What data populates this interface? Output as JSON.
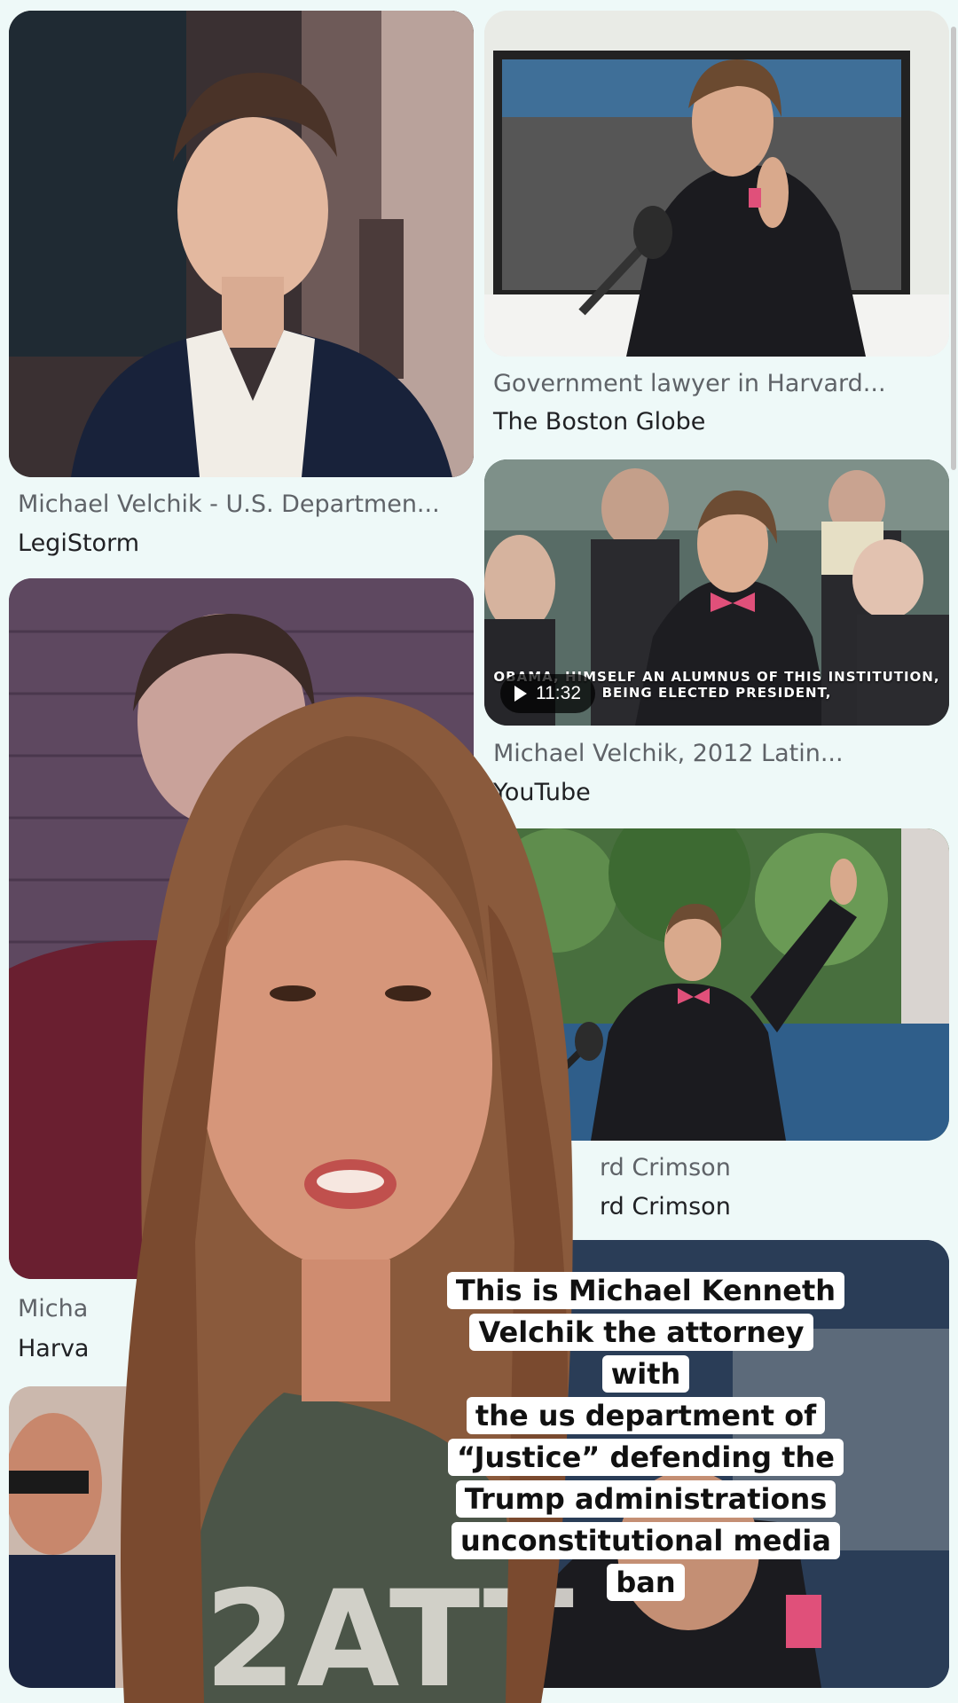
{
  "results": [
    {
      "title": "Michael Velchik - U.S. Departmen...",
      "source": "LegiStorm"
    },
    {
      "title": "Government lawyer in Harvard...",
      "source": "The Boston Globe"
    },
    {
      "title": "Michael Velchik, 2012 Latin...",
      "source": "YouTube",
      "duration": "11:32",
      "banner": "OBAMA, HIMSELF AN ALUMNUS OF THIS INSTITUTION, BEING ELECTED PRESIDENT,"
    },
    {
      "title": "rd Crimson",
      "source": "rd Crimson"
    },
    {
      "title": "Micha",
      "source": "Harva"
    }
  ],
  "overlay": {
    "subtitle_lines": [
      "This is Michael Kenneth",
      "Velchik the attorney with",
      "the us department of",
      "“Justice” defending the",
      "Trump administrations",
      "unconstitutional media",
      "ban"
    ],
    "shirt_text": "2ATT"
  },
  "colors": {
    "page_bg": "#eef9f8",
    "bow_tie": "#e0507a",
    "robe": "#1b1b1f"
  }
}
